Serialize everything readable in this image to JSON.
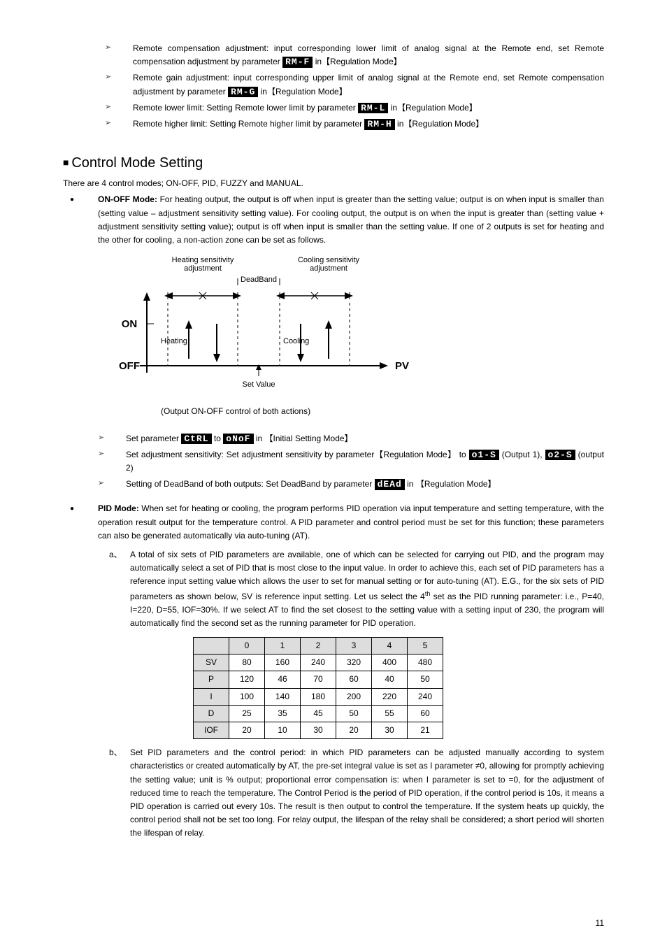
{
  "top_bullets": [
    {
      "pre": "Remote compensation adjustment: input corresponding lower limit of analog signal at the Remote end, set Remote compensation adjustment by parameter ",
      "lcd": "RM-F",
      "post": " in【Regulation Mode】"
    },
    {
      "pre": "Remote gain adjustment: input corresponding upper limit of analog signal at the Remote end, set Remote compensation adjustment by parameter ",
      "lcd": "RM-G",
      "post": " in【Regulation Mode】"
    },
    {
      "pre": "Remote lower limit: Setting Remote lower limit by parameter ",
      "lcd": "RM-L",
      "post": " in【Regulation Mode】"
    },
    {
      "pre": "Remote higher limit: Setting Remote higher limit by parameter ",
      "lcd": "RM-H",
      "post": " in【Regulation Mode】"
    }
  ],
  "section_title": "Control Mode Setting",
  "intro": "There are 4 control modes; ON-OFF, PID, FUZZY and MANUAL.",
  "onoff": {
    "title": "ON-OFF Mode:",
    "body": " For heating output, the output is off when input is greater than the setting value; output is on when input is smaller than (setting value – adjustment sensitivity setting value). For cooling output, the output is on when the input is greater than (setting value + adjustment sensitivity setting value); output is off when input is smaller than the setting value. If one of 2 outputs is set for heating and the other for cooling, a non-action zone can be set as follows."
  },
  "diagram": {
    "heat_sens": "Heating sensitivity adjustment",
    "cool_sens": "Cooling sensitivity adjustment",
    "deadband": "DeadBand",
    "on": "ON",
    "off": "OFF",
    "heating": "Heating",
    "cooling": "Cooling",
    "pv": "PV",
    "setvalue": "Set Value",
    "caption": "(Output ON-OFF control of both actions)"
  },
  "onoff_bullets": {
    "b1": {
      "pre": "Set parameter ",
      "lcd1": "CtRL",
      "mid": " to ",
      "lcd2": "oNoF",
      "post": " in 【Initial Setting Mode】"
    },
    "b2": {
      "pre": "Set adjustment sensitivity: Set adjustment sensitivity by parameter【Regulation Mode】 to ",
      "lcd1": "o1-S",
      "mid": " (Output 1), ",
      "lcd2": "o2-S",
      "post": " (output 2)"
    },
    "b3": {
      "pre": "Setting of DeadBand of both outputs: Set DeadBand by parameter ",
      "lcd": "dEAd",
      "post": " in 【Regulation Mode】"
    }
  },
  "pid": {
    "title": "PID Mode:",
    "intro": " When set for heating or cooling, the program performs PID operation via input temperature and setting temperature, with the operation result output for the temperature control. A PID parameter and control period must be set for this function; these parameters can also be generated automatically via auto-tuning (AT).",
    "a": "A total of six sets of PID parameters are available, one of which can be selected for carrying out PID, and the program may automatically select a set of PID that is most close to the input value. In order to achieve this, each set of PID parameters has a reference input setting value which allows the user to set for manual setting or for auto-tuning (AT). E.G., for the six sets of PID parameters as shown below, SV is reference input setting. Let us select the 4",
    "a_sup": "th",
    "a2": " set as the PID running parameter: i.e., P=40, I=220, D=55, IOF=30%. If we select AT to find the set closest to the setting value with a setting input of 230, the program will automatically find the second set as the running parameter for PID operation.",
    "b": "Set PID parameters and the control period: in which PID parameters can be adjusted manually according to system characteristics or created automatically by AT, the pre-set integral value is set as I parameter ≠0, allowing for promptly achieving the setting value; unit is % output; proportional error compensation is: when I parameter is set to =0, for the adjustment of reduced time to reach the temperature. The Control Period is the period of PID operation, if the control period is 10s, it means a PID operation is carried out every 10s. The result is then output to control the temperature. If the system heats up quickly, the control period shall not be set too long. For relay output, the lifespan of the relay shall be considered; a short period will shorten the lifespan of relay."
  },
  "pid_table": {
    "headers": [
      "",
      "0",
      "1",
      "2",
      "3",
      "4",
      "5"
    ],
    "rows": [
      {
        "label": "SV",
        "vals": [
          "80",
          "160",
          "240",
          "320",
          "400",
          "480"
        ]
      },
      {
        "label": "P",
        "vals": [
          "120",
          "46",
          "70",
          "60",
          "40",
          "50"
        ]
      },
      {
        "label": "I",
        "vals": [
          "100",
          "140",
          "180",
          "200",
          "220",
          "240"
        ]
      },
      {
        "label": "D",
        "vals": [
          "25",
          "35",
          "45",
          "50",
          "55",
          "60"
        ]
      },
      {
        "label": "IOF",
        "vals": [
          "20",
          "10",
          "30",
          "20",
          "30",
          "21"
        ]
      }
    ]
  },
  "pagenum": "11"
}
